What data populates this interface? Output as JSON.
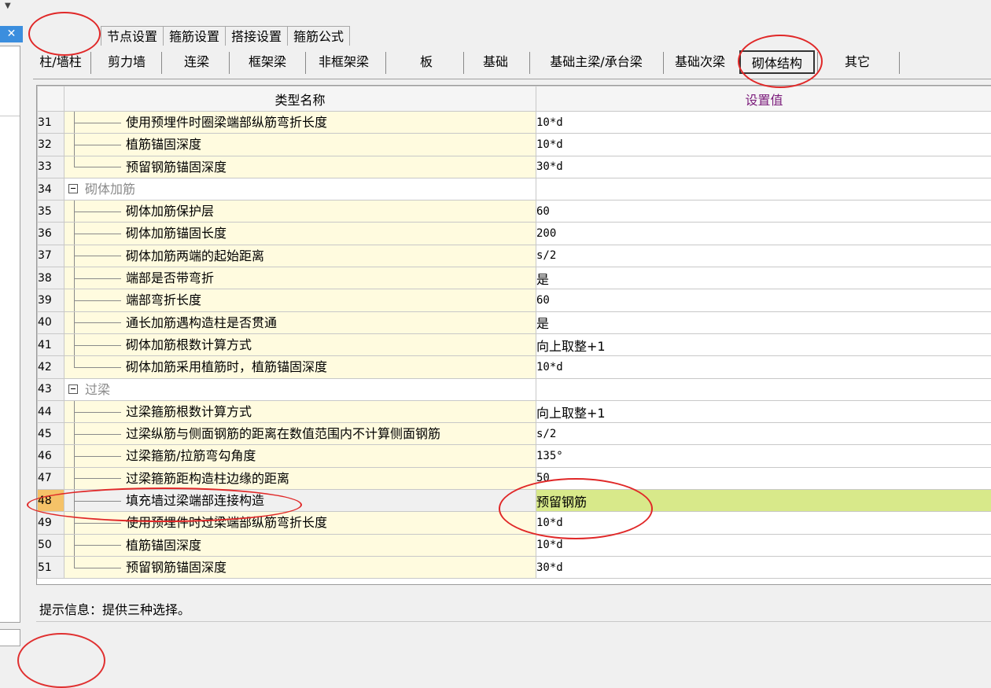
{
  "top_tabs": [
    "节点设置",
    "箍筋设置",
    "搭接设置",
    "箍筋公式"
  ],
  "sub_tabs": [
    "柱/墙柱",
    "剪力墙",
    "连梁",
    "框架梁",
    "非框架梁",
    "板",
    "基础",
    "基础主梁/承台梁",
    "基础次梁",
    "砌体结构",
    "其它"
  ],
  "active_sub_tab": "砌体结构",
  "grid": {
    "headers": {
      "name": "类型名称",
      "value": "设置值"
    },
    "rows": [
      {
        "num": "31",
        "name": "使用预埋件时圈梁端部纵筋弯折长度",
        "value": "10*d",
        "last": false
      },
      {
        "num": "32",
        "name": "植筋锚固深度",
        "value": "10*d",
        "last": false
      },
      {
        "num": "33",
        "name": "预留钢筋锚固深度",
        "value": "30*d",
        "last": true
      },
      {
        "num": "34",
        "name": "砌体加筋",
        "value": "",
        "group": true
      },
      {
        "num": "35",
        "name": "砌体加筋保护层",
        "value": "60"
      },
      {
        "num": "36",
        "name": "砌体加筋锚固长度",
        "value": "200"
      },
      {
        "num": "37",
        "name": "砌体加筋两端的起始距离",
        "value": "s/2"
      },
      {
        "num": "38",
        "name": "端部是否带弯折",
        "value": "是"
      },
      {
        "num": "39",
        "name": "端部弯折长度",
        "value": "60"
      },
      {
        "num": "40",
        "name": "通长加筋遇构造柱是否贯通",
        "value": "是"
      },
      {
        "num": "41",
        "name": "砌体加筋根数计算方式",
        "value": "向上取整+1"
      },
      {
        "num": "42",
        "name": "砌体加筋采用植筋时，植筋锚固深度",
        "value": "10*d",
        "last": true
      },
      {
        "num": "43",
        "name": "过梁",
        "value": "",
        "group": true
      },
      {
        "num": "44",
        "name": "过梁箍筋根数计算方式",
        "value": "向上取整+1"
      },
      {
        "num": "45",
        "name": "过梁纵筋与侧面钢筋的距离在数值范围内不计算侧面钢筋",
        "value": "s/2"
      },
      {
        "num": "46",
        "name": "过梁箍筋/拉筋弯勾角度",
        "value": "135°"
      },
      {
        "num": "47",
        "name": "过梁箍筋距构造柱边缘的距离",
        "value": "50"
      },
      {
        "num": "48",
        "name": "填充墙过梁端部连接构造",
        "value": "预留钢筋",
        "selected": true
      },
      {
        "num": "49",
        "name": "使用预埋件时过梁端部纵筋弯折长度",
        "value": "10*d"
      },
      {
        "num": "50",
        "name": "植筋锚固深度",
        "value": "10*d"
      },
      {
        "num": "51",
        "name": "预留钢筋锚固深度",
        "value": "30*d",
        "last": true
      }
    ]
  },
  "hint": "提示信息：提供三种选择。",
  "colors": {
    "header_value_bg": "#f5c268",
    "header_value_text": "#7a1a7a",
    "selected_value_bg": "#d8e98a",
    "name_cell_bg": "#fffbdf",
    "annotation_red": "#e02828",
    "close_button_bg": "#3b8ede"
  },
  "icons": [
    "dropdown-arrow-icon",
    "close-icon",
    "collapse-icon"
  ]
}
